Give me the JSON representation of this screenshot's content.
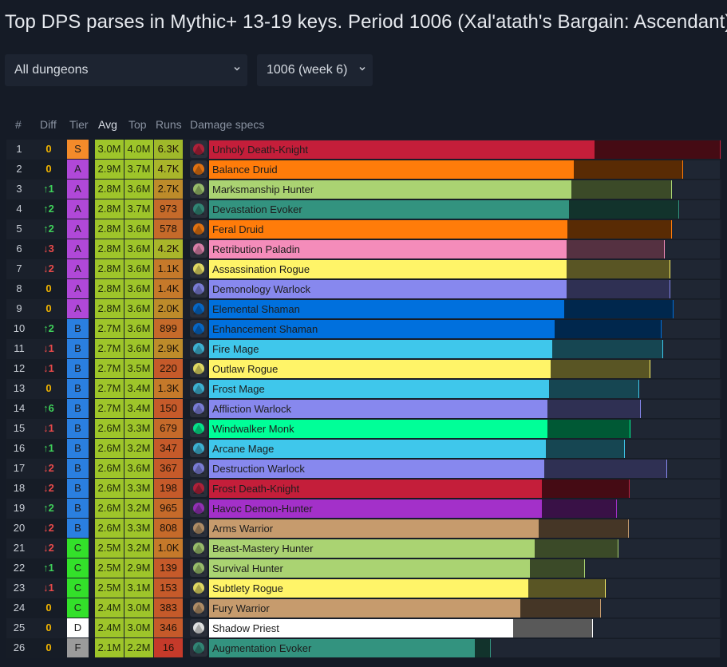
{
  "page": {
    "title": "Top DPS parses in Mythic+ 13-19 keys. Period 1006 (Xal'atath's Bargain: Ascendant)",
    "dungeon_select": "All dungeons",
    "period_select": "1006 (week 6)"
  },
  "headers": {
    "rank": "#",
    "diff": "Diff",
    "tier": "Tier",
    "avg": "Avg",
    "top": "Top",
    "runs": "Runs",
    "specs": "Damage specs"
  },
  "colors": {
    "tiers": {
      "S": "#f48b2a",
      "A": "#b048d8",
      "B": "#2a7fe0",
      "C": "#33e02a",
      "D": "#ffffff",
      "F": "#9b9b9b"
    },
    "avg": "#9ec52a",
    "top": "#9ec52a",
    "runs": "#c56a2a",
    "up": "#3fd15a",
    "down": "#e84a4a",
    "zero": "#f0b400"
  },
  "table_rows": [
    {
      "rank": "1",
      "diff": "0",
      "dir": "zero",
      "tier": "S",
      "avg": "3.0M",
      "top": "4.0M",
      "runs": "6.3K",
      "spec": "Unholy Death-Knight",
      "icon": "unholy-dk-icon",
      "color": "#c41e3a",
      "avg_frac": 0.755,
      "top_frac": 1.0,
      "runs_color": "#9fb82a"
    },
    {
      "rank": "2",
      "diff": "0",
      "dir": "zero",
      "tier": "A",
      "avg": "2.9M",
      "top": "3.7M",
      "runs": "4.7K",
      "spec": "Balance Druid",
      "icon": "balance-druid-icon",
      "color": "#ff7c0a",
      "avg_frac": 0.714,
      "top_frac": 0.927,
      "runs_color": "#a9b52a"
    },
    {
      "rank": "3",
      "diff": "↑1",
      "dir": "up",
      "tier": "A",
      "avg": "2.8M",
      "top": "3.6M",
      "runs": "2.7K",
      "spec": "Marksmanship Hunter",
      "icon": "mm-hunter-icon",
      "color": "#aad372",
      "avg_frac": 0.71,
      "top_frac": 0.904,
      "runs_color": "#bd8b2a"
    },
    {
      "rank": "4",
      "diff": "↑2",
      "dir": "up",
      "tier": "A",
      "avg": "2.8M",
      "top": "3.7M",
      "runs": "973",
      "spec": "Devastation Evoker",
      "icon": "dev-evoker-icon",
      "color": "#33937f",
      "avg_frac": 0.704,
      "top_frac": 0.918,
      "runs_color": "#c56a2a"
    },
    {
      "rank": "5",
      "diff": "↑2",
      "dir": "up",
      "tier": "A",
      "avg": "2.8M",
      "top": "3.6M",
      "runs": "578",
      "spec": "Feral Druid",
      "icon": "feral-druid-icon",
      "color": "#ff7c0a",
      "avg_frac": 0.702,
      "top_frac": 0.904,
      "runs_color": "#c56a2a"
    },
    {
      "rank": "6",
      "diff": "↓3",
      "dir": "down",
      "tier": "A",
      "avg": "2.8M",
      "top": "3.6M",
      "runs": "4.2K",
      "spec": "Retribution Paladin",
      "icon": "ret-paladin-icon",
      "color": "#f48cba",
      "avg_frac": 0.7,
      "top_frac": 0.891,
      "runs_color": "#a9b52a"
    },
    {
      "rank": "7",
      "diff": "↓2",
      "dir": "down",
      "tier": "A",
      "avg": "2.8M",
      "top": "3.6M",
      "runs": "1.1K",
      "spec": "Assassination Rogue",
      "icon": "assa-rogue-icon",
      "color": "#fff468",
      "avg_frac": 0.7,
      "top_frac": 0.901,
      "runs_color": "#c5792a"
    },
    {
      "rank": "8",
      "diff": "0",
      "dir": "zero",
      "tier": "A",
      "avg": "2.8M",
      "top": "3.6M",
      "runs": "1.4K",
      "spec": "Demonology Warlock",
      "icon": "demo-lock-icon",
      "color": "#8788ee",
      "avg_frac": 0.7,
      "top_frac": 0.901,
      "runs_color": "#c5792a"
    },
    {
      "rank": "9",
      "diff": "0",
      "dir": "zero",
      "tier": "A",
      "avg": "2.8M",
      "top": "3.6M",
      "runs": "2.0K",
      "spec": "Elemental Shaman",
      "icon": "ele-shaman-icon",
      "color": "#0070dd",
      "avg_frac": 0.696,
      "top_frac": 0.908,
      "runs_color": "#bd8b2a"
    },
    {
      "rank": "10",
      "diff": "↑2",
      "dir": "up",
      "tier": "B",
      "avg": "2.7M",
      "top": "3.6M",
      "runs": "899",
      "spec": "Enhancement Shaman",
      "icon": "enh-shaman-icon",
      "color": "#0070dd",
      "avg_frac": 0.676,
      "top_frac": 0.885,
      "runs_color": "#c56a2a"
    },
    {
      "rank": "11",
      "diff": "↓1",
      "dir": "down",
      "tier": "B",
      "avg": "2.7M",
      "top": "3.6M",
      "runs": "2.9K",
      "spec": "Fire Mage",
      "icon": "fire-mage-icon",
      "color": "#3fc7eb",
      "avg_frac": 0.672,
      "top_frac": 0.888,
      "runs_color": "#bd8b2a"
    },
    {
      "rank": "12",
      "diff": "↓1",
      "dir": "down",
      "tier": "B",
      "avg": "2.7M",
      "top": "3.5M",
      "runs": "220",
      "spec": "Outlaw Rogue",
      "icon": "outlaw-rogue-icon",
      "color": "#fff468",
      "avg_frac": 0.669,
      "top_frac": 0.862,
      "runs_color": "#c55a2a"
    },
    {
      "rank": "13",
      "diff": "0",
      "dir": "zero",
      "tier": "B",
      "avg": "2.7M",
      "top": "3.4M",
      "runs": "1.3K",
      "spec": "Frost Mage",
      "icon": "frost-mage-icon",
      "color": "#3fc7eb",
      "avg_frac": 0.665,
      "top_frac": 0.84,
      "runs_color": "#c5792a"
    },
    {
      "rank": "14",
      "diff": "↑6",
      "dir": "up",
      "tier": "B",
      "avg": "2.7M",
      "top": "3.4M",
      "runs": "150",
      "spec": "Affliction Warlock",
      "icon": "aff-lock-icon",
      "color": "#8788ee",
      "avg_frac": 0.662,
      "top_frac": 0.844,
      "runs_color": "#c55a2a"
    },
    {
      "rank": "15",
      "diff": "↓1",
      "dir": "down",
      "tier": "B",
      "avg": "2.6M",
      "top": "3.3M",
      "runs": "679",
      "spec": "Windwalker Monk",
      "icon": "ww-monk-icon",
      "color": "#00ff98",
      "avg_frac": 0.662,
      "top_frac": 0.824,
      "runs_color": "#c56a2a"
    },
    {
      "rank": "16",
      "diff": "↑1",
      "dir": "up",
      "tier": "B",
      "avg": "2.6M",
      "top": "3.2M",
      "runs": "347",
      "spec": "Arcane Mage",
      "icon": "arcane-mage-icon",
      "color": "#3fc7eb",
      "avg_frac": 0.659,
      "top_frac": 0.812,
      "runs_color": "#c55a2a"
    },
    {
      "rank": "17",
      "diff": "↓2",
      "dir": "down",
      "tier": "B",
      "avg": "2.6M",
      "top": "3.6M",
      "runs": "367",
      "spec": "Destruction Warlock",
      "icon": "destro-lock-icon",
      "color": "#8788ee",
      "avg_frac": 0.657,
      "top_frac": 0.895,
      "runs_color": "#c55a2a"
    },
    {
      "rank": "18",
      "diff": "↓2",
      "dir": "down",
      "tier": "B",
      "avg": "2.6M",
      "top": "3.3M",
      "runs": "198",
      "spec": "Frost Death-Knight",
      "icon": "frost-dk-icon",
      "color": "#c41e3a",
      "avg_frac": 0.651,
      "top_frac": 0.822,
      "runs_color": "#c55a2a"
    },
    {
      "rank": "19",
      "diff": "↑2",
      "dir": "up",
      "tier": "B",
      "avg": "2.6M",
      "top": "3.2M",
      "runs": "965",
      "spec": "Havoc Demon-Hunter",
      "icon": "havoc-dh-icon",
      "color": "#a330c9",
      "avg_frac": 0.651,
      "top_frac": 0.797,
      "runs_color": "#c56a2a"
    },
    {
      "rank": "20",
      "diff": "↓2",
      "dir": "down",
      "tier": "B",
      "avg": "2.6M",
      "top": "3.3M",
      "runs": "808",
      "spec": "Arms Warrior",
      "icon": "arms-warrior-icon",
      "color": "#c69b6d",
      "avg_frac": 0.645,
      "top_frac": 0.821,
      "runs_color": "#c56a2a"
    },
    {
      "rank": "21",
      "diff": "↓2",
      "dir": "down",
      "tier": "C",
      "avg": "2.5M",
      "top": "3.2M",
      "runs": "1.0K",
      "spec": "Beast-Mastery Hunter",
      "icon": "bm-hunter-icon",
      "color": "#aad372",
      "avg_frac": 0.638,
      "top_frac": 0.8,
      "runs_color": "#c5792a"
    },
    {
      "rank": "22",
      "diff": "↑1",
      "dir": "up",
      "tier": "C",
      "avg": "2.5M",
      "top": "2.9M",
      "runs": "139",
      "spec": "Survival Hunter",
      "icon": "surv-hunter-icon",
      "color": "#aad372",
      "avg_frac": 0.628,
      "top_frac": 0.735,
      "runs_color": "#c55a2a"
    },
    {
      "rank": "23",
      "diff": "↓1",
      "dir": "down",
      "tier": "C",
      "avg": "2.5M",
      "top": "3.1M",
      "runs": "153",
      "spec": "Subtlety Rogue",
      "icon": "sub-rogue-icon",
      "color": "#fff468",
      "avg_frac": 0.625,
      "top_frac": 0.775,
      "runs_color": "#c55a2a"
    },
    {
      "rank": "24",
      "diff": "0",
      "dir": "zero",
      "tier": "C",
      "avg": "2.4M",
      "top": "3.0M",
      "runs": "383",
      "spec": "Fury Warrior",
      "icon": "fury-warrior-icon",
      "color": "#c69b6d",
      "avg_frac": 0.61,
      "top_frac": 0.765,
      "runs_color": "#c55a2a"
    },
    {
      "rank": "25",
      "diff": "0",
      "dir": "zero",
      "tier": "D",
      "avg": "2.4M",
      "top": "3.0M",
      "runs": "346",
      "spec": "Shadow Priest",
      "icon": "shadow-priest-icon",
      "color": "#ffffff",
      "avg_frac": 0.595,
      "top_frac": 0.75,
      "runs_color": "#c55a2a"
    },
    {
      "rank": "26",
      "diff": "0",
      "dir": "zero",
      "tier": "F",
      "avg": "2.1M",
      "top": "2.2M",
      "runs": "16",
      "spec": "Augmentation Evoker",
      "icon": "aug-evoker-icon",
      "color": "#33937f",
      "avg_frac": 0.52,
      "top_frac": 0.55,
      "runs_color": "#c53a2a"
    }
  ]
}
